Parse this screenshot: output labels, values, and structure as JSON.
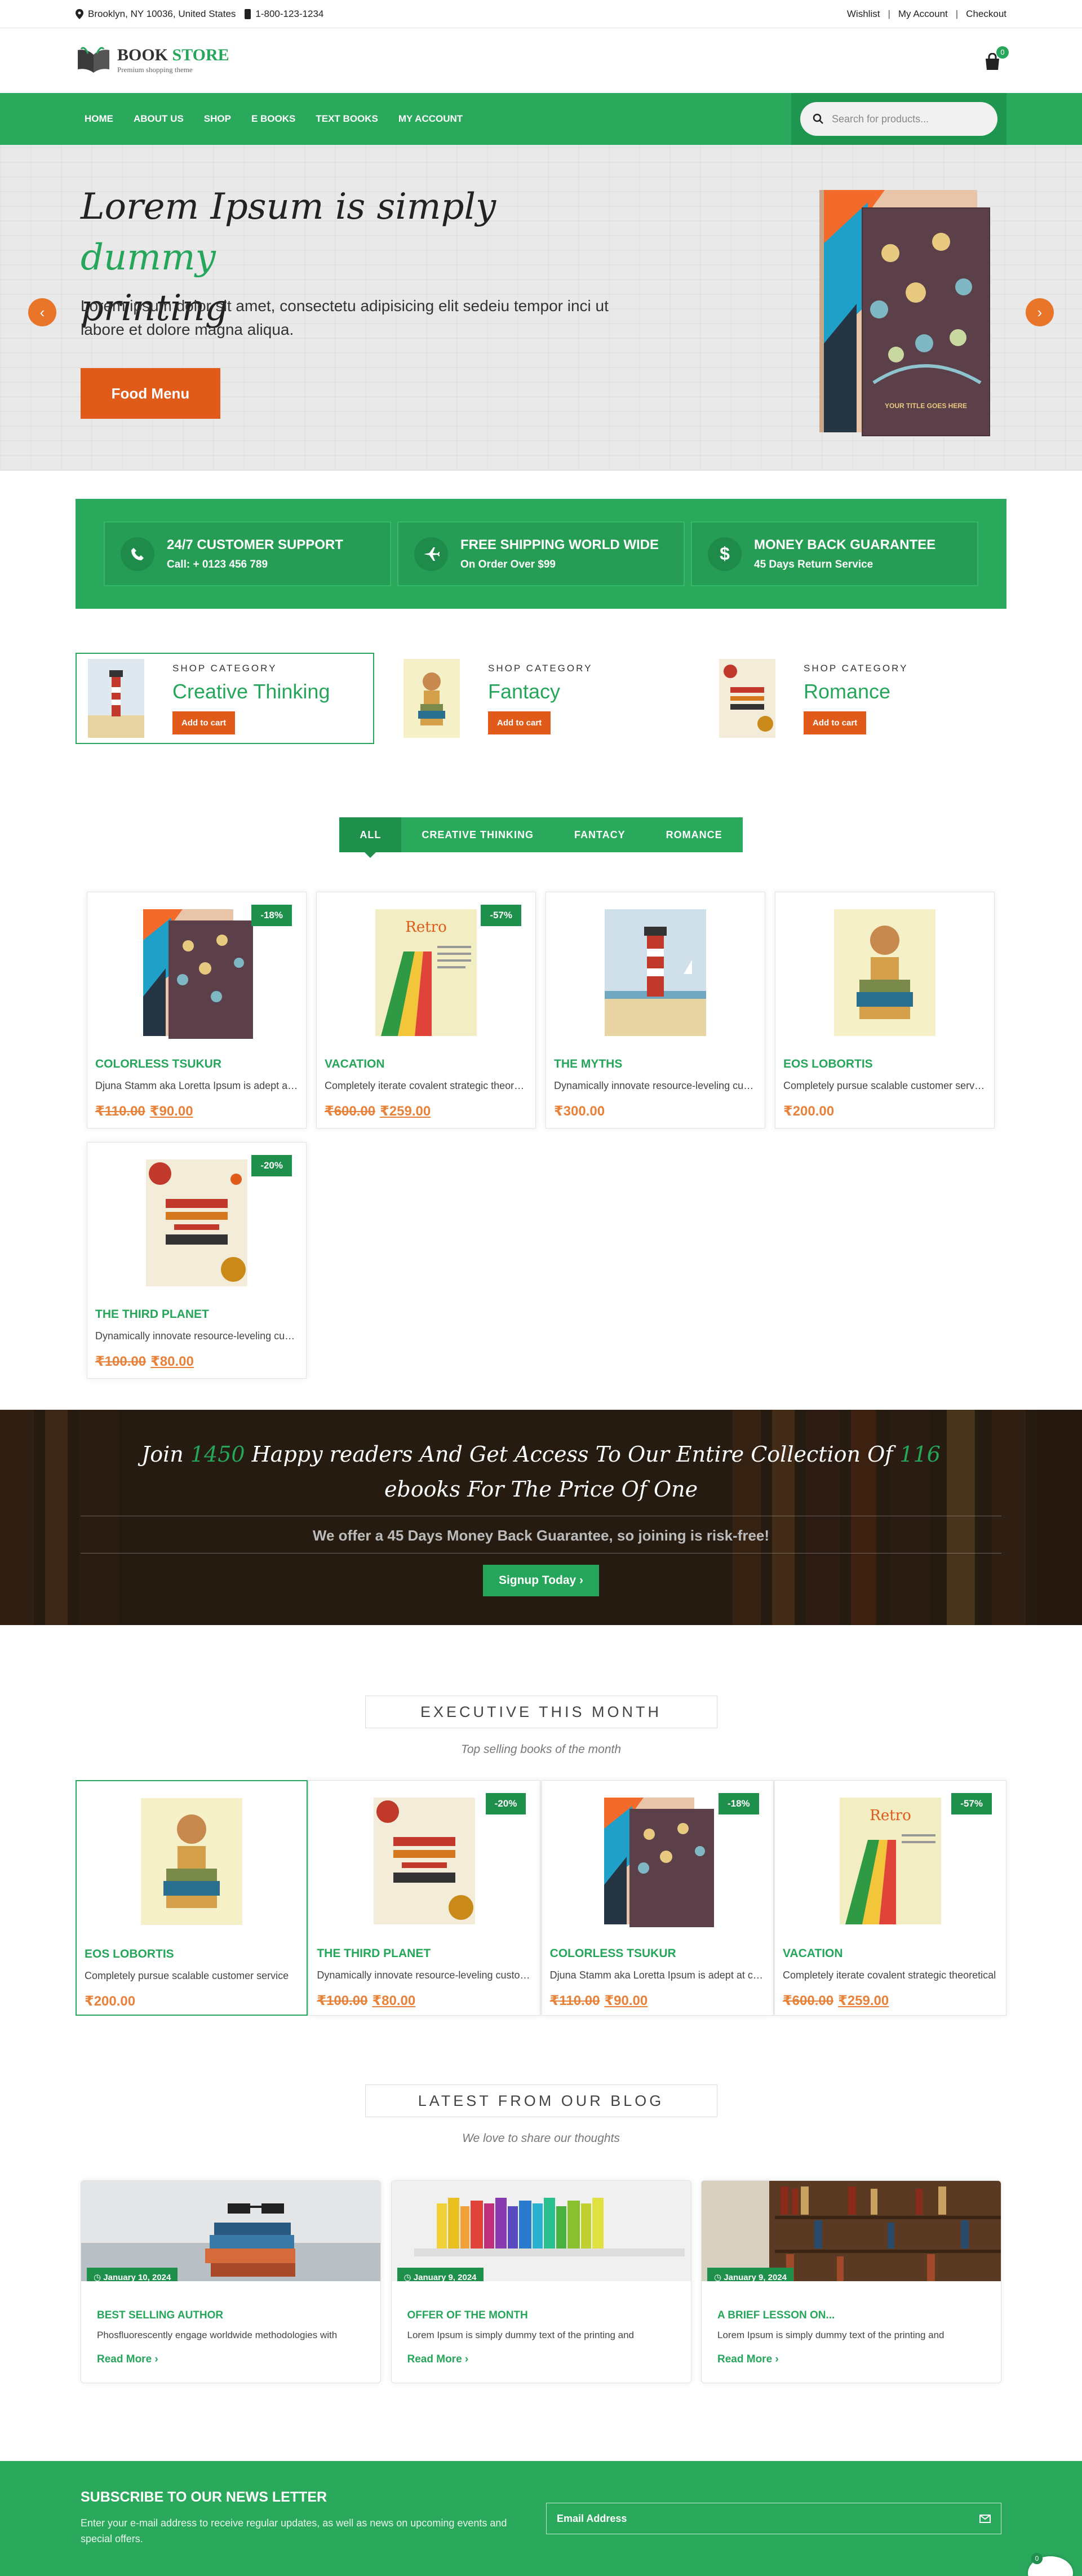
{
  "topbar": {
    "address": "Brooklyn, NY 10036, United States",
    "phone": "1-800-123-1234",
    "links": [
      "Wishlist",
      "My Account",
      "Checkout"
    ]
  },
  "header": {
    "logo_title_1": "BOOK",
    "logo_title_2": "STORE",
    "logo_sub": "Premium shopping theme",
    "cart_count": "0"
  },
  "nav": {
    "items": [
      "HOME",
      "ABOUT US",
      "SHOP",
      "E BOOKS",
      "TEXT BOOKS",
      "MY ACCOUNT"
    ],
    "search_placeholder": "Search for products..."
  },
  "hero": {
    "title_1": "Lorem Ipsum is simply ",
    "title_highlight": "dummy",
    "title_2": "printing",
    "text": "Lorem ipsum dolor sit amet, consectetu adipisicing elit sedeiu tempor inci ut labore et dolore magna aliqua.",
    "button": "Food Menu",
    "book_caption": "YOUR TITLE GOES HERE"
  },
  "features": [
    {
      "title": "24/7 CUSTOMER SUPPORT",
      "text": "Call: + 0123 456 789",
      "icon": "phone-icon"
    },
    {
      "title": "FREE SHIPPING WORLD WIDE",
      "text": "On Order Over $99",
      "icon": "plane-icon"
    },
    {
      "title": "MONEY BACK GUARANTEE",
      "text": "45 Days Return Service",
      "icon": "dollar-icon"
    }
  ],
  "categories": [
    {
      "label": "SHOP CATEGORY",
      "name": "Creative Thinking",
      "button": "Add to cart"
    },
    {
      "label": "SHOP CATEGORY",
      "name": "Fantacy",
      "button": "Add to cart"
    },
    {
      "label": "SHOP CATEGORY",
      "name": "Romance",
      "button": "Add to cart"
    }
  ],
  "tabs": [
    "ALL",
    "CREATIVE THINKING",
    "FANTACY",
    "ROMANCE"
  ],
  "products": [
    {
      "name": "COLORLESS TSUKUR",
      "desc": "Djuna Stamm aka Loretta Ipsum is adept at creating",
      "old": "₹110.00",
      "price": "₹90.00",
      "discount": "-18%"
    },
    {
      "name": "VACATION",
      "desc": "Completely iterate covalent strategic theoretical",
      "old": "₹600.00",
      "price": "₹259.00",
      "discount": "-57%"
    },
    {
      "name": "THE MYTHS",
      "desc": "Dynamically innovate resource-leveling customer",
      "old": "",
      "price": "₹300.00",
      "discount": ""
    },
    {
      "name": "EOS LOBORTIS",
      "desc": "Completely pursue scalable customer service",
      "old": "",
      "price": "₹200.00",
      "discount": ""
    },
    {
      "name": "THE THIRD PLANET",
      "desc": "Dynamically innovate resource-leveling customer",
      "old": "₹100.00",
      "price": "₹80.00",
      "discount": "-20%"
    }
  ],
  "banner": {
    "line_1a": "Join ",
    "line_1n": "1450",
    "line_1b": " Happy readers And Get Access To Our Entire Collection Of ",
    "line_1m": "116",
    "line_2": "ebooks For The Price Of One",
    "text": "We offer a 45 Days Money Back Guarantee, so joining is risk-free!",
    "button": "Signup Today"
  },
  "executive": {
    "title": "EXECUTIVE THIS MONTH",
    "subtitle": "Top selling books of the month",
    "items": [
      {
        "name": "EOS LOBORTIS",
        "desc": "Completely pursue scalable customer service",
        "old": "",
        "price": "₹200.00",
        "discount": ""
      },
      {
        "name": "THE THIRD PLANET",
        "desc": "Dynamically innovate resource-leveling customer",
        "old": "₹100.00",
        "price": "₹80.00",
        "discount": "-20%"
      },
      {
        "name": "COLORLESS TSUKUR",
        "desc": "Djuna Stamm aka Loretta Ipsum is adept at creating",
        "old": "₹110.00",
        "price": "₹90.00",
        "discount": "-18%"
      },
      {
        "name": "VACATION",
        "desc": "Completely iterate covalent strategic theoretical",
        "old": "₹600.00",
        "price": "₹259.00",
        "discount": "-57%"
      }
    ]
  },
  "blog": {
    "title": "LATEST FROM OUR BLOG",
    "subtitle": "We love to share our thoughts",
    "posts": [
      {
        "date": "January 10, 2024",
        "title": "BEST SELLING AUTHOR",
        "desc": "Phosfluorescently engage worldwide methodologies with",
        "more": "Read More"
      },
      {
        "date": "January 9, 2024",
        "title": "OFFER OF THE MONTH",
        "desc": "Lorem Ipsum is simply dummy text of the printing and",
        "more": "Read More"
      },
      {
        "date": "January 9, 2024",
        "title": "A BRIEF LESSON ON...",
        "desc": "Lorem Ipsum is simply dummy text of the printing and",
        "more": "Read More"
      }
    ]
  },
  "newsletter": {
    "title": "SUBSCRIBE TO OUR NEWS LETTER",
    "text": "Enter your e-mail address to receive regular updates, as well as news on upcoming events and special offers.",
    "field": "Email Address",
    "fab_count": "0"
  },
  "colors": {
    "brand": "#2aa85c",
    "accent": "#e05a1a",
    "price": "#e8823a"
  }
}
